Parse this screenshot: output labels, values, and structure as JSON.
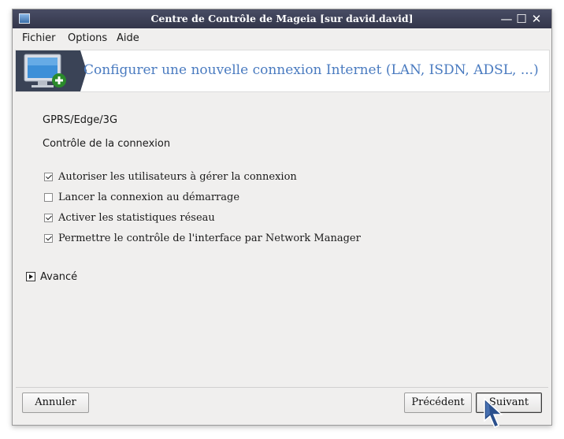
{
  "window": {
    "title": "Centre de Contrôle de Mageia  [sur david.david]",
    "controls": {
      "minimize": "—",
      "maximize": "☐",
      "close": "✕"
    }
  },
  "menu": {
    "items": [
      "Fichier",
      "Options",
      "Aide"
    ]
  },
  "banner": {
    "heading": "Configurer une nouvelle connexion Internet (LAN, ISDN, ADSL, ...)"
  },
  "content": {
    "connection_type": "GPRS/Edge/3G",
    "section_label": "Contrôle de la connexion",
    "options": [
      {
        "label": "Autoriser les utilisateurs à gérer la connexion",
        "checked": true
      },
      {
        "label": "Lancer la connexion au démarrage",
        "checked": false
      },
      {
        "label": "Activer les statistiques réseau",
        "checked": true
      },
      {
        "label": "Permettre le contrôle de l'interface par Network Manager",
        "checked": true
      }
    ],
    "advanced_label": "Avancé"
  },
  "buttons": {
    "cancel": "Annuler",
    "previous": "Précédent",
    "next": "Suivant"
  },
  "colors": {
    "heading": "#4a7bc0",
    "titlebar": "#3a3d52",
    "banner_icon_bg": "#3a4356"
  }
}
